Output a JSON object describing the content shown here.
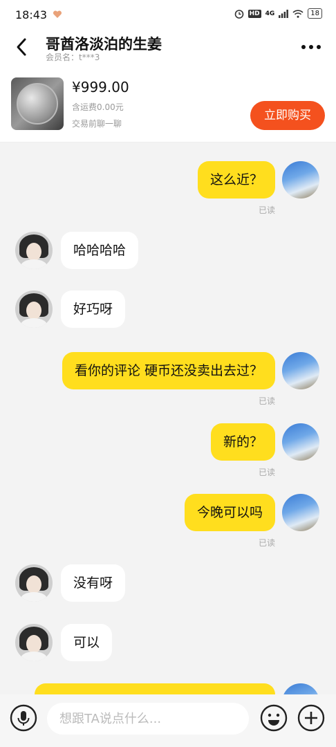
{
  "status": {
    "time": "18:43",
    "network": "4G",
    "battery": "18"
  },
  "header": {
    "title": "哥酋洛淡泊的生姜",
    "subtitle": "会员名：t***3"
  },
  "product": {
    "price": "¥999.00",
    "shipping": "含运费0.00元",
    "hint": "交易前聊一聊",
    "buy_label": "立即购买"
  },
  "messages": [
    {
      "side": "me",
      "text": "这么近？",
      "status": "已读"
    },
    {
      "side": "them",
      "text": "哈哈哈哈"
    },
    {
      "side": "them",
      "text": "好巧呀"
    },
    {
      "side": "me",
      "text": "看你的评论  硬币还没卖出去过？",
      "status": "已读"
    },
    {
      "side": "me",
      "text": "新的？",
      "status": "已读"
    },
    {
      "side": "me",
      "text": "今晚可以吗",
      "status": "已读"
    },
    {
      "side": "them",
      "text": "没有呀"
    },
    {
      "side": "them",
      "text": "可以"
    },
    {
      "side": "me",
      "text": ""
    }
  ],
  "input": {
    "placeholder": "想跟TA说点什么..."
  },
  "colors": {
    "accent": "#f4511e",
    "my_bubble": "#ffde1e",
    "background": "#f3f3f3"
  },
  "icons": [
    "back-icon",
    "more-icon",
    "mic-icon",
    "emoji-icon",
    "plus-icon"
  ]
}
